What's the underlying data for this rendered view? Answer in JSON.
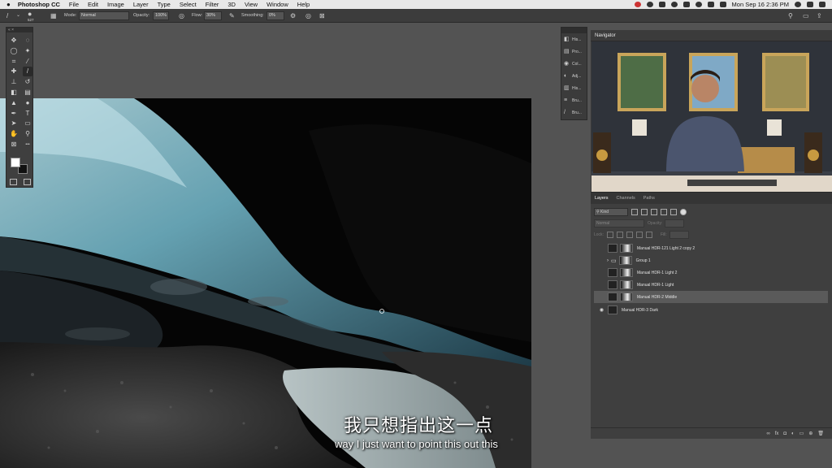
{
  "menubar": {
    "apple": "",
    "app_name": "Photoshop CC",
    "items": [
      "File",
      "Edit",
      "Image",
      "Layer",
      "Type",
      "Select",
      "Filter",
      "3D",
      "View",
      "Window",
      "Help"
    ],
    "datetime": "Mon Sep 16  2:36 PM"
  },
  "options_bar": {
    "brush_size": "527",
    "mode_label": "Mode:",
    "mode_value": "Normal",
    "opacity_label": "Opacity:",
    "opacity_value": "100%",
    "flow_label": "Flow:",
    "flow_value": "30%",
    "smoothing_label": "Smoothing:",
    "smoothing_value": "0%"
  },
  "tools_panel": {
    "header": "« ×",
    "tools": [
      {
        "name": "move-tool",
        "glyph": "✥"
      },
      {
        "name": "lasso-select-tool",
        "glyph": "◌"
      },
      {
        "name": "lasso-tool",
        "glyph": "◯"
      },
      {
        "name": "magic-wand-tool",
        "glyph": "✦"
      },
      {
        "name": "crop-tool",
        "glyph": "⌗"
      },
      {
        "name": "eyedropper-tool",
        "glyph": "⁄"
      },
      {
        "name": "healing-tool",
        "glyph": "✚"
      },
      {
        "name": "brush-tool",
        "glyph": "/"
      },
      {
        "name": "stamp-tool",
        "glyph": "⊥"
      },
      {
        "name": "history-brush-tool",
        "glyph": "↺"
      },
      {
        "name": "eraser-tool",
        "glyph": "◧"
      },
      {
        "name": "gradient-tool",
        "glyph": "▤"
      },
      {
        "name": "blur-tool",
        "glyph": "▲"
      },
      {
        "name": "dodge-tool",
        "glyph": "●"
      },
      {
        "name": "pen-tool",
        "glyph": "✒"
      },
      {
        "name": "type-tool",
        "glyph": "T"
      },
      {
        "name": "path-select-tool",
        "glyph": "➤"
      },
      {
        "name": "shape-tool",
        "glyph": "▭"
      },
      {
        "name": "hand-tool",
        "glyph": "✋"
      },
      {
        "name": "zoom-tool",
        "glyph": "⚲"
      },
      {
        "name": "frame-tool",
        "glyph": "⊠"
      },
      {
        "name": "more-tools",
        "glyph": "•••"
      }
    ],
    "active_index": 7,
    "foreground_color": "#ffffff",
    "background_color": "#111111"
  },
  "subtitle": {
    "zh": "我只想指出这一点",
    "en": "way I just want to point this out this"
  },
  "panel_strip": {
    "items": [
      {
        "icon": "history-icon",
        "glyph": "◧",
        "label": "His..."
      },
      {
        "icon": "properties-icon",
        "glyph": "▤",
        "label": "Pro..."
      },
      {
        "icon": "color-icon",
        "glyph": "◉",
        "label": "Col..."
      },
      {
        "icon": "adjustments-icon",
        "glyph": "◐",
        "label": "Adj..."
      },
      {
        "icon": "histogram-icon",
        "glyph": "▥",
        "label": "His..."
      },
      {
        "icon": "brush-settings-icon",
        "glyph": "≡",
        "label": "Bru..."
      },
      {
        "icon": "brushes-icon",
        "glyph": "/",
        "label": "Bru..."
      }
    ]
  },
  "navigator": {
    "title": "Navigator"
  },
  "layers_panel": {
    "tabs": [
      "Layers",
      "Channels",
      "Paths"
    ],
    "kind_label": "⚲ Kind",
    "blend_mode": "Normal",
    "opacity_label": "Opacity:",
    "lock_label": "Lock:",
    "fill_label": "Fill:",
    "layers": [
      {
        "name": "Manual HDR-121 Light 2 copy 2",
        "visible": false,
        "selected": false,
        "has_mask": true,
        "group": false
      },
      {
        "name": "Group 1",
        "visible": false,
        "selected": false,
        "has_mask": true,
        "group": true
      },
      {
        "name": "Manual HDR-1 Light 2",
        "visible": false,
        "selected": false,
        "has_mask": true,
        "group": false
      },
      {
        "name": "Manual HDR-1 Light",
        "visible": false,
        "selected": false,
        "has_mask": true,
        "group": false
      },
      {
        "name": "Manual HDR-2 Middle",
        "visible": false,
        "selected": true,
        "has_mask": true,
        "group": false
      },
      {
        "name": "Manual HDR-3 Dark",
        "visible": true,
        "selected": false,
        "has_mask": false,
        "group": false
      }
    ],
    "footer_icons": [
      "link-icon",
      "fx-icon",
      "mask-icon",
      "adjustment-icon",
      "folder-icon",
      "new-layer-icon",
      "trash-icon"
    ]
  }
}
